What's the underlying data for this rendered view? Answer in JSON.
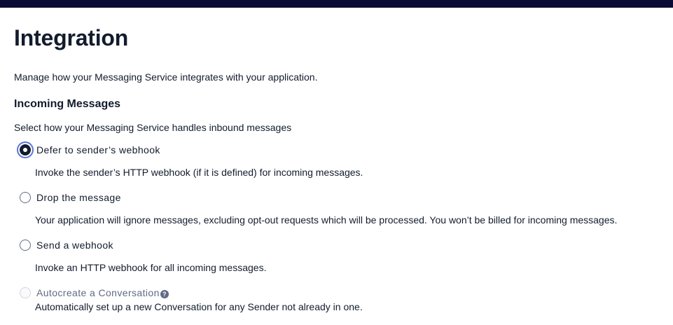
{
  "page": {
    "title": "Integration",
    "description": "Manage how your Messaging Service integrates with your application."
  },
  "incoming": {
    "title": "Incoming Messages",
    "description": "Select how your Messaging Service handles inbound messages",
    "options": [
      {
        "label": "Defer to sender’s webhook",
        "help": "Invoke the sender’s HTTP webhook (if it is defined) for incoming messages.",
        "checked": true,
        "disabled": false
      },
      {
        "label": "Drop the message",
        "help": "Your application will ignore messages, excluding opt-out requests which will be processed. You won’t be billed for incoming messages.",
        "checked": false,
        "disabled": false
      },
      {
        "label": "Send a webhook",
        "help": "Invoke an HTTP webhook for all incoming messages.",
        "checked": false,
        "disabled": false
      },
      {
        "label": "Autocreate a Conversation",
        "help": "Automatically set up a new Conversation for any Sender not already in one.",
        "checked": false,
        "disabled": true,
        "help_icon": "question-circle-icon"
      }
    ]
  },
  "colors": {
    "topbar": "#0b0c35",
    "text": "#121c2d",
    "focus_ring": "#5a75d8",
    "disabled_text": "#606b85"
  }
}
